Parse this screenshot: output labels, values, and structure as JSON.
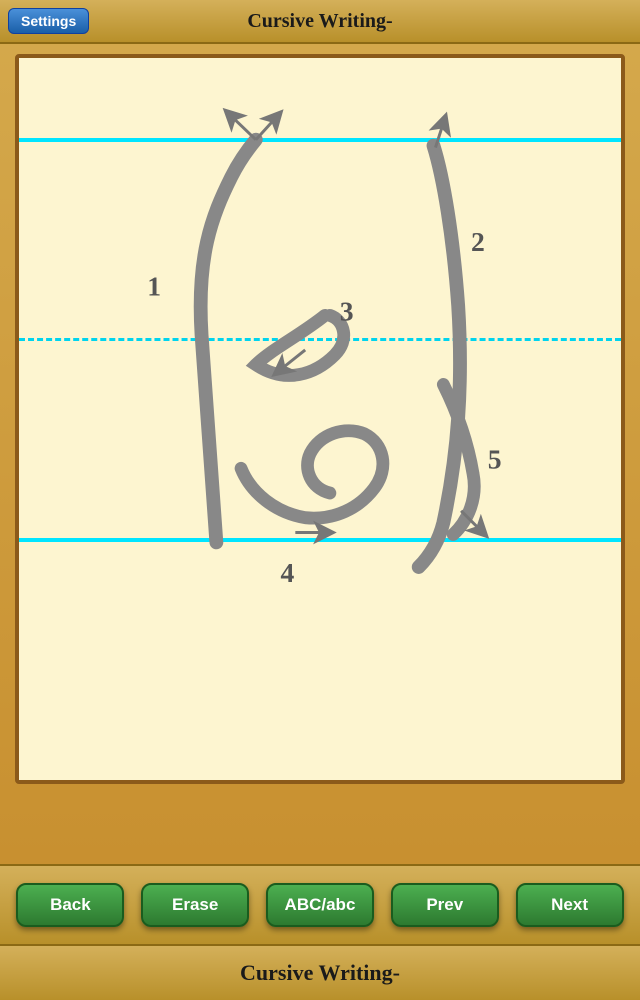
{
  "header": {
    "settings_label": "Settings",
    "title": "Cursive Writing-"
  },
  "writing": {
    "stroke_numbers": [
      "1",
      "2",
      "3",
      "4",
      "5"
    ]
  },
  "buttons": {
    "back": "Back",
    "erase": "Erase",
    "abc": "ABC/abc",
    "prev": "Prev",
    "next": "Next"
  },
  "footer": {
    "title": "Cursive Writing-"
  }
}
